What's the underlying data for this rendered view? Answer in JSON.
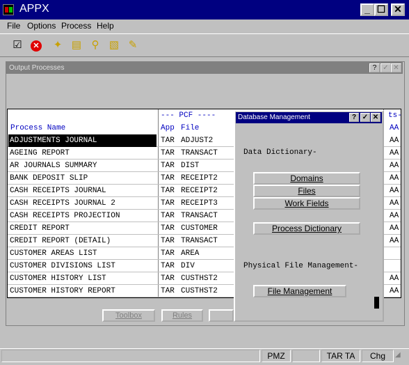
{
  "window": {
    "title": "APPX"
  },
  "menu": [
    "File",
    "Options",
    "Process",
    "Help"
  ],
  "toolbar_icons": [
    "check-icon",
    "cancel-icon",
    "new-icon",
    "open-icon",
    "find-icon",
    "delete-icon",
    "edit-icon"
  ],
  "output": {
    "title": "Output Processes",
    "header_pcf": "--- PCF ----",
    "col_process": "Process Name",
    "col_app": "App",
    "col_file": "File",
    "col_right_top": "ts-",
    "col_right": "AA",
    "rows": [
      {
        "name": "ADJUSTMENTS JOURNAL",
        "app": "TAR",
        "file": "ADJUST2",
        "right": "AA"
      },
      {
        "name": "AGEING REPORT",
        "app": "TAR",
        "file": "TRANSACT",
        "right": "AA"
      },
      {
        "name": "AR JOURNALS SUMMARY",
        "app": "TAR",
        "file": "DIST",
        "right": "AA"
      },
      {
        "name": "BANK DEPOSIT SLIP",
        "app": "TAR",
        "file": "RECEIPT2",
        "right": "AA"
      },
      {
        "name": "CASH RECEIPTS JOURNAL",
        "app": "TAR",
        "file": "RECEIPT2",
        "right": "AA"
      },
      {
        "name": "CASH RECEIPTS JOURNAL 2",
        "app": "TAR",
        "file": "RECEIPT3",
        "right": "AA"
      },
      {
        "name": "CASH RECEIPTS PROJECTION",
        "app": "TAR",
        "file": "TRANSACT",
        "right": "AA"
      },
      {
        "name": "CREDIT REPORT",
        "app": "TAR",
        "file": "CUSTOMER",
        "right": "AA"
      },
      {
        "name": "CREDIT REPORT (DETAIL)",
        "app": "TAR",
        "file": "TRANSACT",
        "right": "AA"
      },
      {
        "name": "CUSTOMER AREAS LIST",
        "app": "TAR",
        "file": "AREA",
        "right": ""
      },
      {
        "name": "CUSTOMER DIVISIONS LIST",
        "app": "TAR",
        "file": "DIV",
        "right": ""
      },
      {
        "name": "CUSTOMER HISTORY LIST",
        "app": "TAR",
        "file": "CUSTHST2",
        "right": "AA"
      },
      {
        "name": "CUSTOMER HISTORY REPORT",
        "app": "TAR",
        "file": "CUSTHST2",
        "right": "AA"
      }
    ],
    "buttons": [
      "Toolbox",
      "Rules"
    ]
  },
  "dialog": {
    "title": "Database Management",
    "data_dictionary_label": "Data Dictionary-",
    "buttons_dd": [
      "Domains",
      "Files",
      "Work Fields"
    ],
    "process_dictionary": "Process Dictionary",
    "physical_label": "Physical File Management-",
    "file_management": "File Management"
  },
  "statusbar": {
    "pmz": "PMZ",
    "tar": "TAR TA",
    "chg": "Chg"
  },
  "colors": {
    "title_bg": "#000080",
    "selected_bg": "#000000",
    "header_text": "#0000c0"
  }
}
